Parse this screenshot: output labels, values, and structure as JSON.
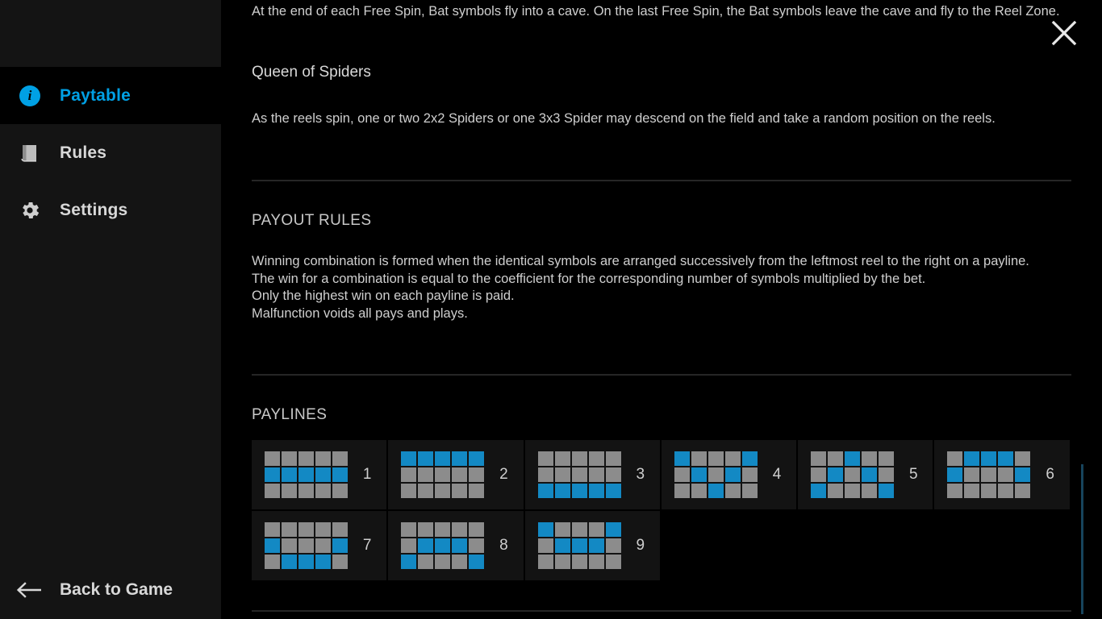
{
  "sidebar": {
    "items": [
      {
        "id": "paytable",
        "label": "Paytable",
        "icon": "info-circle-icon",
        "active": true
      },
      {
        "id": "rules",
        "label": "Rules",
        "icon": "book-icon",
        "active": false
      },
      {
        "id": "settings",
        "label": "Settings",
        "icon": "gear-icon",
        "active": false
      }
    ],
    "back_button": {
      "label": "Back to Game",
      "icon": "arrow-left-icon"
    }
  },
  "content": {
    "close_icon": "✕",
    "intro_paragraph": "At the end of each Free Spin, Bat symbols fly into a cave. On the last Free Spin, the Bat symbols leave the cave and fly to the Reel Zone.",
    "feature_title": "Queen of Spiders",
    "feature_paragraph": "As the reels spin, one or two 2x2 Spiders or one 3x3 Spider may descend on the field and take a random position on the reels.",
    "payout_rules_heading": "PAYOUT RULES",
    "payout_rules": [
      "Winning combination is formed when the identical symbols are arranged successively from the leftmost reel to the right on a payline.",
      "The win for a combination is equal to the coefficient for the corresponding number of symbols multiplied by the bet.",
      "Only the highest win on each payline is paid.",
      "Malfunction voids all pays and plays."
    ],
    "paylines_heading": "PAYLINES",
    "paylines": [
      {
        "number": "1",
        "rows": [
          [
            0,
            0,
            0,
            0,
            0
          ],
          [
            1,
            1,
            1,
            1,
            1
          ],
          [
            0,
            0,
            0,
            0,
            0
          ]
        ]
      },
      {
        "number": "2",
        "rows": [
          [
            1,
            1,
            1,
            1,
            1
          ],
          [
            0,
            0,
            0,
            0,
            0
          ],
          [
            0,
            0,
            0,
            0,
            0
          ]
        ]
      },
      {
        "number": "3",
        "rows": [
          [
            0,
            0,
            0,
            0,
            0
          ],
          [
            0,
            0,
            0,
            0,
            0
          ],
          [
            1,
            1,
            1,
            1,
            1
          ]
        ]
      },
      {
        "number": "4",
        "rows": [
          [
            1,
            0,
            0,
            0,
            1
          ],
          [
            0,
            1,
            0,
            1,
            0
          ],
          [
            0,
            0,
            1,
            0,
            0
          ]
        ]
      },
      {
        "number": "5",
        "rows": [
          [
            0,
            0,
            1,
            0,
            0
          ],
          [
            0,
            1,
            0,
            1,
            0
          ],
          [
            1,
            0,
            0,
            0,
            1
          ]
        ]
      },
      {
        "number": "6",
        "rows": [
          [
            0,
            1,
            1,
            1,
            0
          ],
          [
            1,
            0,
            0,
            0,
            1
          ],
          [
            0,
            0,
            0,
            0,
            0
          ]
        ]
      },
      {
        "number": "7",
        "rows": [
          [
            0,
            0,
            0,
            0,
            0
          ],
          [
            1,
            0,
            0,
            0,
            1
          ],
          [
            0,
            1,
            1,
            1,
            0
          ]
        ]
      },
      {
        "number": "8",
        "rows": [
          [
            0,
            0,
            0,
            0,
            0
          ],
          [
            0,
            1,
            1,
            1,
            0
          ],
          [
            1,
            0,
            0,
            0,
            1
          ]
        ]
      },
      {
        "number": "9",
        "rows": [
          [
            1,
            0,
            0,
            0,
            1
          ],
          [
            0,
            1,
            1,
            1,
            0
          ],
          [
            0,
            0,
            0,
            0,
            0
          ]
        ]
      }
    ]
  },
  "colors": {
    "accent_blue": "#00a0e4",
    "cell_active": "#1389c4",
    "cell_inactive": "#8c8c8c",
    "sidebar_bg": "#141414",
    "content_bg": "#000000",
    "scrollbar": "#17445c"
  }
}
